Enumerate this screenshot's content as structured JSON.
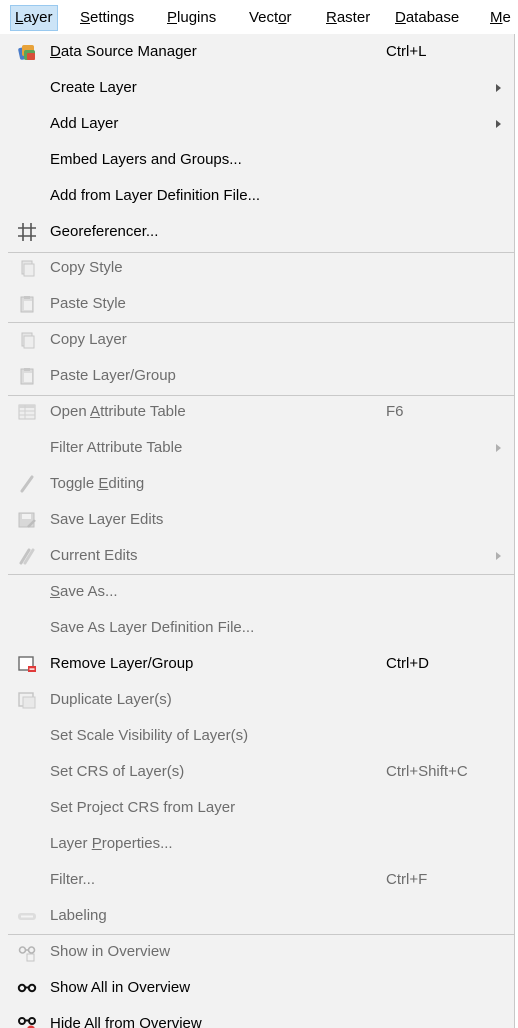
{
  "menubar": {
    "items": [
      {
        "pre": "",
        "u": "L",
        "post": "ayer",
        "active": true
      },
      {
        "pre": "",
        "u": "S",
        "post": "ettings"
      },
      {
        "pre": "",
        "u": "P",
        "post": "lugins"
      },
      {
        "pre": "Vect",
        "u": "o",
        "post": "r"
      },
      {
        "pre": "",
        "u": "R",
        "post": "aster"
      },
      {
        "pre": "",
        "u": "D",
        "post": "atabase"
      },
      {
        "pre": "",
        "u": "M",
        "post": "e"
      }
    ]
  },
  "menu": {
    "items": [
      {
        "label_pre": "",
        "label_u": "D",
        "label_post": "ata Source Manager",
        "shortcut": "Ctrl+L",
        "icon": "data-source-manager-icon",
        "enabled": true
      },
      {
        "label_pre": "Create Layer",
        "shortcut": "",
        "submenu": true,
        "enabled": true
      },
      {
        "label_pre": "Add Layer",
        "shortcut": "",
        "submenu": true,
        "enabled": true
      },
      {
        "label_pre": "Embed Layers and Groups...",
        "shortcut": "",
        "enabled": true
      },
      {
        "label_pre": "Add from Layer Definition File...",
        "shortcut": "",
        "enabled": true
      },
      {
        "label_pre": "Georeferencer...",
        "shortcut": "",
        "icon": "georeferencer-icon",
        "enabled": true
      },
      {
        "separator": true
      },
      {
        "label_pre": "Copy Style",
        "shortcut": "",
        "icon": "copy-style-icon",
        "enabled": false
      },
      {
        "label_pre": "Paste Style",
        "shortcut": "",
        "icon": "paste-style-icon",
        "enabled": false
      },
      {
        "separator": true
      },
      {
        "label_pre": "Copy Layer",
        "shortcut": "",
        "icon": "copy-layer-icon",
        "enabled": false
      },
      {
        "label_pre": "Paste Layer/Group",
        "shortcut": "",
        "icon": "paste-layer-icon",
        "enabled": false
      },
      {
        "separator": true
      },
      {
        "label_pre": "Open ",
        "label_u": "A",
        "label_post": "ttribute Table",
        "shortcut": "F6",
        "icon": "attribute-table-icon",
        "enabled": false
      },
      {
        "label_pre": "Filter Attribute Table",
        "shortcut": "",
        "submenu": true,
        "enabled": false
      },
      {
        "label_pre": "Toggle ",
        "label_u": "E",
        "label_post": "diting",
        "shortcut": "",
        "icon": "pencil-icon",
        "enabled": false
      },
      {
        "label_pre": "Save Layer Edits",
        "shortcut": "",
        "icon": "save-edits-icon",
        "enabled": false
      },
      {
        "label_pre": "Current Edits",
        "shortcut": "",
        "icon": "current-edits-icon",
        "submenu": true,
        "enabled": false
      },
      {
        "separator": true
      },
      {
        "label_pre": "",
        "label_u": "S",
        "label_post": "ave As...",
        "shortcut": "",
        "enabled": false
      },
      {
        "label_pre": "Save As Layer Definition File...",
        "shortcut": "",
        "enabled": false
      },
      {
        "label_pre": "Remove Layer/Group",
        "shortcut": "Ctrl+D",
        "icon": "remove-layer-icon",
        "enabled": true
      },
      {
        "label_pre": "Duplicate Layer(s)",
        "shortcut": "",
        "icon": "duplicate-layer-icon",
        "enabled": false
      },
      {
        "label_pre": "Set Scale Visibility of Layer(s)",
        "shortcut": "",
        "enabled": false
      },
      {
        "label_pre": "Set CRS of Layer(s)",
        "shortcut": "Ctrl+Shift+C",
        "enabled": false
      },
      {
        "label_pre": "Set Project CRS from Layer",
        "shortcut": "",
        "enabled": false
      },
      {
        "label_pre": "Layer ",
        "label_u": "P",
        "label_post": "roperties...",
        "shortcut": "",
        "enabled": false
      },
      {
        "label_pre": "Filter...",
        "shortcut": "Ctrl+F",
        "enabled": false
      },
      {
        "label_pre": "Labeling",
        "shortcut": "",
        "icon": "labeling-icon",
        "enabled": false
      },
      {
        "separator": true
      },
      {
        "label_pre": "Show in Overview",
        "shortcut": "",
        "icon": "show-in-overview-icon",
        "enabled": false
      },
      {
        "label_pre": "Show All in Overview",
        "shortcut": "",
        "icon": "show-all-overview-icon",
        "enabled": true
      },
      {
        "label_pre": "Hide All from Overview",
        "shortcut": "",
        "icon": "hide-all-overview-icon",
        "enabled": true
      }
    ]
  }
}
